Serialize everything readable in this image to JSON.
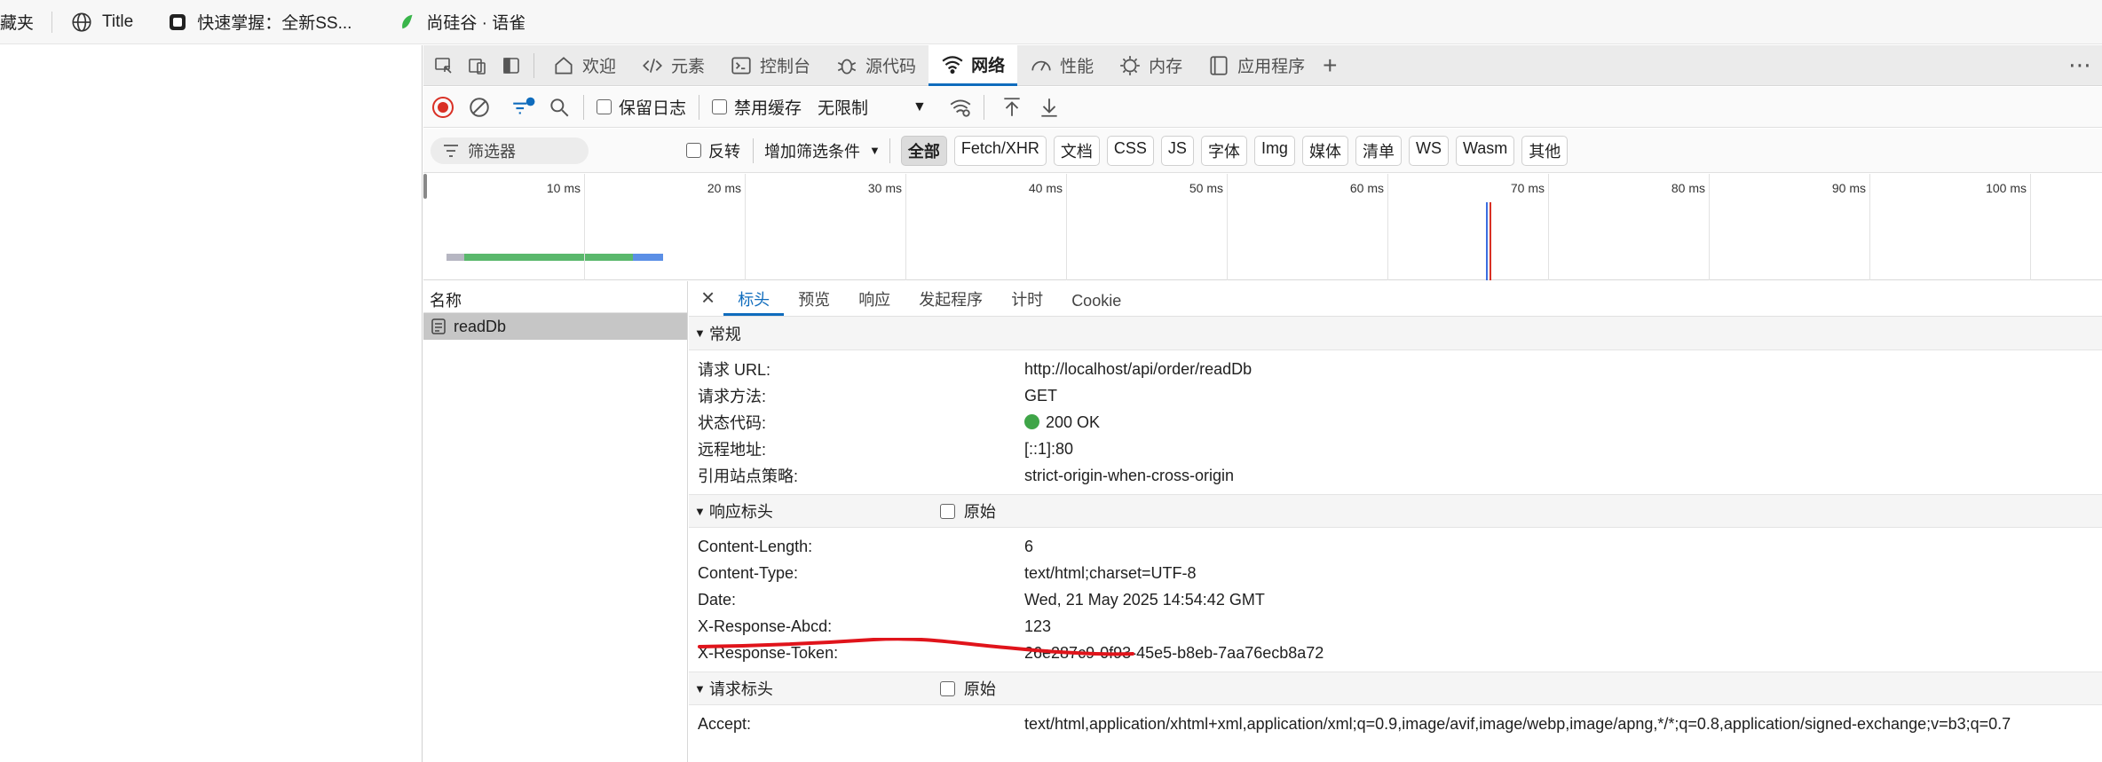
{
  "bookmarks": {
    "items": [
      {
        "label": "藏夹",
        "icon": "none"
      },
      {
        "label": "Title",
        "icon": "globe-icon"
      },
      {
        "label": "快速掌握：全新SS...",
        "icon": "page-icon"
      },
      {
        "label": "尚硅谷 · 语雀",
        "icon": "yuque-icon"
      }
    ]
  },
  "devtools": {
    "tabs": [
      {
        "label": "欢迎",
        "icon": "home-icon"
      },
      {
        "label": "元素",
        "icon": "code-icon"
      },
      {
        "label": "控制台",
        "icon": "console-icon"
      },
      {
        "label": "源代码",
        "icon": "bug-icon"
      },
      {
        "label": "网络",
        "icon": "wifi-icon",
        "active": true
      },
      {
        "label": "性能",
        "icon": "gauge-icon"
      },
      {
        "label": "内存",
        "icon": "chip-icon"
      },
      {
        "label": "应用程序",
        "icon": "app-icon"
      }
    ],
    "add_tab": "+",
    "more": "⋯"
  },
  "toolbar": {
    "preserve_log": "保留日志",
    "disable_cache": "禁用缓存",
    "throttling": "无限制"
  },
  "filterbar": {
    "filter_placeholder": "筛选器",
    "invert": "反转",
    "more_filters": "增加筛选条件",
    "types": [
      "全部",
      "Fetch/XHR",
      "文档",
      "CSS",
      "JS",
      "字体",
      "Img",
      "媒体",
      "清单",
      "WS",
      "Wasm",
      "其他"
    ],
    "selected": "全部"
  },
  "timeline": {
    "ticks": [
      "10 ms",
      "20 ms",
      "30 ms",
      "40 ms",
      "50 ms",
      "60 ms",
      "70 ms",
      "80 ms",
      "90 ms",
      "100 ms"
    ]
  },
  "requests": {
    "column_header": "名称",
    "rows": [
      {
        "name": "readDb"
      }
    ]
  },
  "details": {
    "tabs": [
      "标头",
      "预览",
      "响应",
      "发起程序",
      "计时",
      "Cookie"
    ],
    "active_tab": "标头",
    "general": {
      "title": "常规",
      "rows": [
        {
          "key": "请求 URL:",
          "value": "http://localhost/api/order/readDb"
        },
        {
          "key": "请求方法:",
          "value": "GET"
        },
        {
          "key": "状态代码:",
          "value": "200 OK"
        },
        {
          "key": "远程地址:",
          "value": "[::1]:80"
        },
        {
          "key": "引用站点策略:",
          "value": "strict-origin-when-cross-origin"
        }
      ]
    },
    "response_headers": {
      "title": "响应标头",
      "raw_label": "原始",
      "rows": [
        {
          "key": "Content-Length:",
          "value": "6"
        },
        {
          "key": "Content-Type:",
          "value": "text/html;charset=UTF-8"
        },
        {
          "key": "Date:",
          "value": "Wed, 21 May 2025 14:54:42 GMT"
        },
        {
          "key": "X-Response-Abcd:",
          "value": "123"
        },
        {
          "key": "X-Response-Token:",
          "value": "26e287c9-0f93-45e5-b8eb-7aa76ecb8a72"
        }
      ]
    },
    "request_headers": {
      "title": "请求标头",
      "raw_label": "原始",
      "rows": [
        {
          "key": "Accept:",
          "value": "text/html,application/xhtml+xml,application/xml;q=0.9,image/avif,image/webp,image/apng,*/*;q=0.8,application/signed-exchange;v=b3;q=0.7"
        }
      ]
    }
  },
  "colors": {
    "accent": "#0f6cbd",
    "annotation": "#e0141b",
    "status_ok": "#3fa548"
  }
}
